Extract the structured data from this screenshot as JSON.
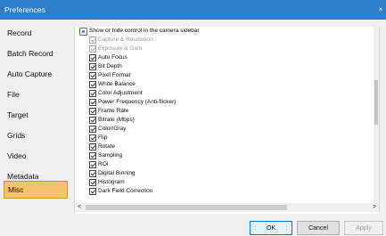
{
  "window": {
    "title": "Preferences",
    "close_glyph": "×"
  },
  "sidebar": {
    "items": [
      {
        "label": "Record"
      },
      {
        "label": "Batch Record"
      },
      {
        "label": "Auto Capture"
      },
      {
        "label": "File"
      },
      {
        "label": "Target"
      },
      {
        "label": "Grids"
      },
      {
        "label": "Video"
      },
      {
        "label": "Metadata"
      },
      {
        "label": "Misc",
        "selected": true
      }
    ]
  },
  "panel": {
    "header": "Show or hide control in the camera sidebar",
    "options": [
      {
        "label": "Capture & Resolution",
        "checked": true,
        "disabled": true
      },
      {
        "label": "Exposure & Gain",
        "checked": true,
        "disabled": true
      },
      {
        "label": "Auto Focus",
        "checked": true
      },
      {
        "label": "Bit Depth",
        "checked": true
      },
      {
        "label": "Pixel Format",
        "checked": true
      },
      {
        "label": "White Balance",
        "checked": true
      },
      {
        "label": "Color Adjustment",
        "checked": true
      },
      {
        "label": "Power Frequency (Anti-flicker)",
        "checked": true
      },
      {
        "label": "Frame Rate",
        "checked": true
      },
      {
        "label": "Bitrate (Mbps)",
        "checked": true
      },
      {
        "label": "Color/Gray",
        "checked": true
      },
      {
        "label": "Flip",
        "checked": true
      },
      {
        "label": "Rotate",
        "checked": true
      },
      {
        "label": "Sampling",
        "checked": true
      },
      {
        "label": "ROI",
        "checked": true
      },
      {
        "label": "Digital Binning",
        "checked": true
      },
      {
        "label": "Histogram",
        "checked": true
      },
      {
        "label": "Dark Field Correction",
        "checked": true
      }
    ]
  },
  "scroll": {
    "left_glyph": "<",
    "right_glyph": ">"
  },
  "buttons": {
    "ok": "OK",
    "cancel": "Cancel",
    "apply": "Apply"
  }
}
